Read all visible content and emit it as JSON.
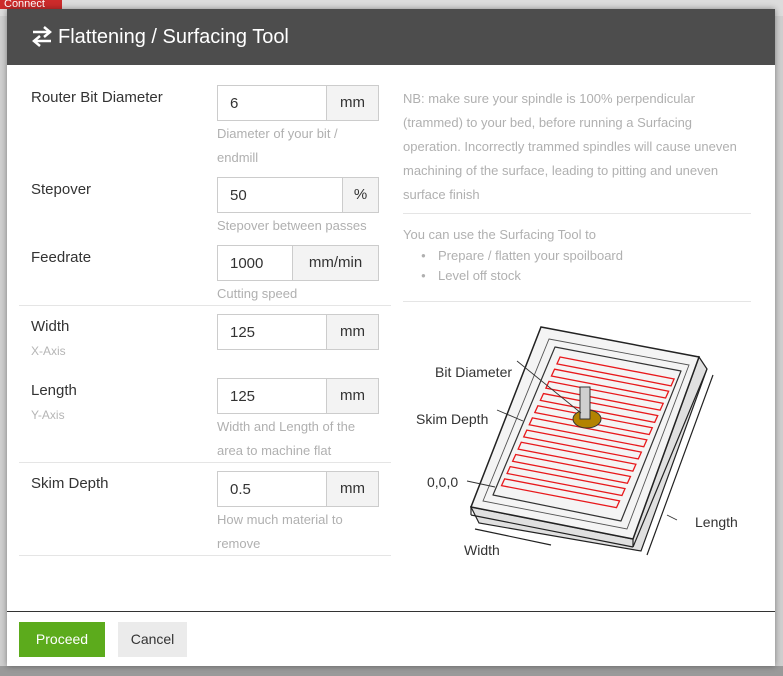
{
  "background": {
    "connect_label": "Connect"
  },
  "modal": {
    "title": "Flattening / Surfacing Tool",
    "icon": "swap-arrows-icon"
  },
  "form": {
    "router_bit": {
      "label": "Router Bit Diameter",
      "value": "6",
      "unit": "mm",
      "help": [
        "Diameter of your bit /",
        "endmill"
      ]
    },
    "stepover": {
      "label": "Stepover",
      "value": "50",
      "unit": "%",
      "help": "Stepover between passes"
    },
    "feedrate": {
      "label": "Feedrate",
      "value": "1000",
      "unit": "mm/min",
      "help": "Cutting speed"
    },
    "width": {
      "label": "Width",
      "sublabel": "X-Axis",
      "value": "125",
      "unit": "mm"
    },
    "length": {
      "label": "Length",
      "sublabel": "Y-Axis",
      "value": "125",
      "unit": "mm",
      "help": [
        "Width and Length of the",
        "area to machine flat"
      ]
    },
    "skim_depth": {
      "label": "Skim Depth",
      "value": "0.5",
      "unit": "mm",
      "help": [
        "How much material to",
        "remove"
      ]
    }
  },
  "info": {
    "note_lines": [
      "NB: make sure your spindle is 100% perpendicular",
      "(trammed) to your bed, before running a Surfacing",
      "operation. Incorrectly trammed spindles will cause uneven",
      "machining of the surface, leading to pitting and uneven",
      "surface finish"
    ],
    "usage_intro": "You can use the Surfacing Tool to",
    "usage_items": [
      "Prepare / flatten your spoilboard",
      "Level off stock"
    ]
  },
  "diagram": {
    "labels": {
      "bit_diameter": "Bit Diameter",
      "skim_depth": "Skim Depth",
      "origin": "0,0,0",
      "length": "Length",
      "width": "Width"
    },
    "toolpath_color": "#e8191c"
  },
  "footer": {
    "proceed": "Proceed",
    "cancel": "Cancel"
  }
}
